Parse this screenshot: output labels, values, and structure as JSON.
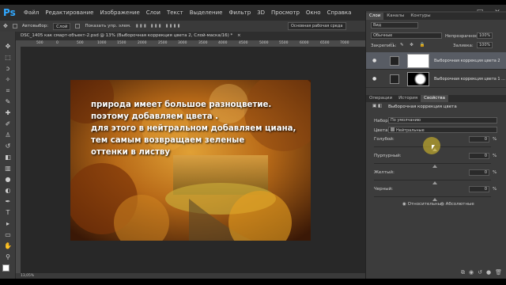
{
  "menubar": {
    "logo": "Ps",
    "items": [
      "Файл",
      "Редактирование",
      "Изображение",
      "Слои",
      "Текст",
      "Выделение",
      "Фильтр",
      "3D",
      "Просмотр",
      "Окно",
      "Справка"
    ]
  },
  "optionsbar": {
    "auto_select_label": "Автовыбор:",
    "auto_select_value": "Слой",
    "show_controls_label": "Показать упр. элем.",
    "workspace": "Основная рабочая среда"
  },
  "document": {
    "tab_title": "DSC_1405 как смарт-объект-2.psd @ 13% (Выборочная коррекция цвета 2, Слой-маска/16) *",
    "overlay_text": [
      "природа имеет большое разноцветие.",
      " поэтому добавляем цвета .",
      "для этого в нейтральном добавляем циана,",
      "тем самым возвращаем зеленые",
      "оттенки в листву"
    ],
    "ruler_ticks": [
      "500",
      "0",
      "500",
      "1000",
      "1500",
      "2000",
      "2500",
      "3000",
      "3500",
      "4000",
      "4500",
      "5000",
      "5500",
      "6000",
      "6500",
      "7000"
    ]
  },
  "layers_panel": {
    "tabs": [
      "Слои",
      "Каналы",
      "Контуры"
    ],
    "kind_label": "Вид",
    "blend_mode": "Обычные",
    "opacity_label": "Непрозрачность:",
    "opacity_value": "100%",
    "lock_label": "Закрепить:",
    "fill_label": "Заливка:",
    "fill_value": "100%",
    "layers": [
      {
        "name": "Выборочная коррекция цвета 2",
        "selected": true
      },
      {
        "name": "Выборочная коррекция цвета 1 ...",
        "selected": false
      }
    ]
  },
  "properties_panel": {
    "tabs": [
      "Операции",
      "История",
      "Свойства"
    ],
    "title": "Выборочная коррекция цвета",
    "preset_label": "Набор:",
    "preset_value": "По умолчанию",
    "colors_label": "Цвета:",
    "colors_value": "Нейтральные",
    "sliders": [
      {
        "label": "Голубой:",
        "value": "0",
        "unit": "%"
      },
      {
        "label": "Пурпурный:",
        "value": "0",
        "unit": "%"
      },
      {
        "label": "Желтый:",
        "value": "0",
        "unit": "%"
      },
      {
        "label": "Черный:",
        "value": "0",
        "unit": "%"
      }
    ],
    "method_relative": "Относительные",
    "method_absolute": "Абсолютные"
  },
  "status": {
    "zoom": "13,05%"
  }
}
